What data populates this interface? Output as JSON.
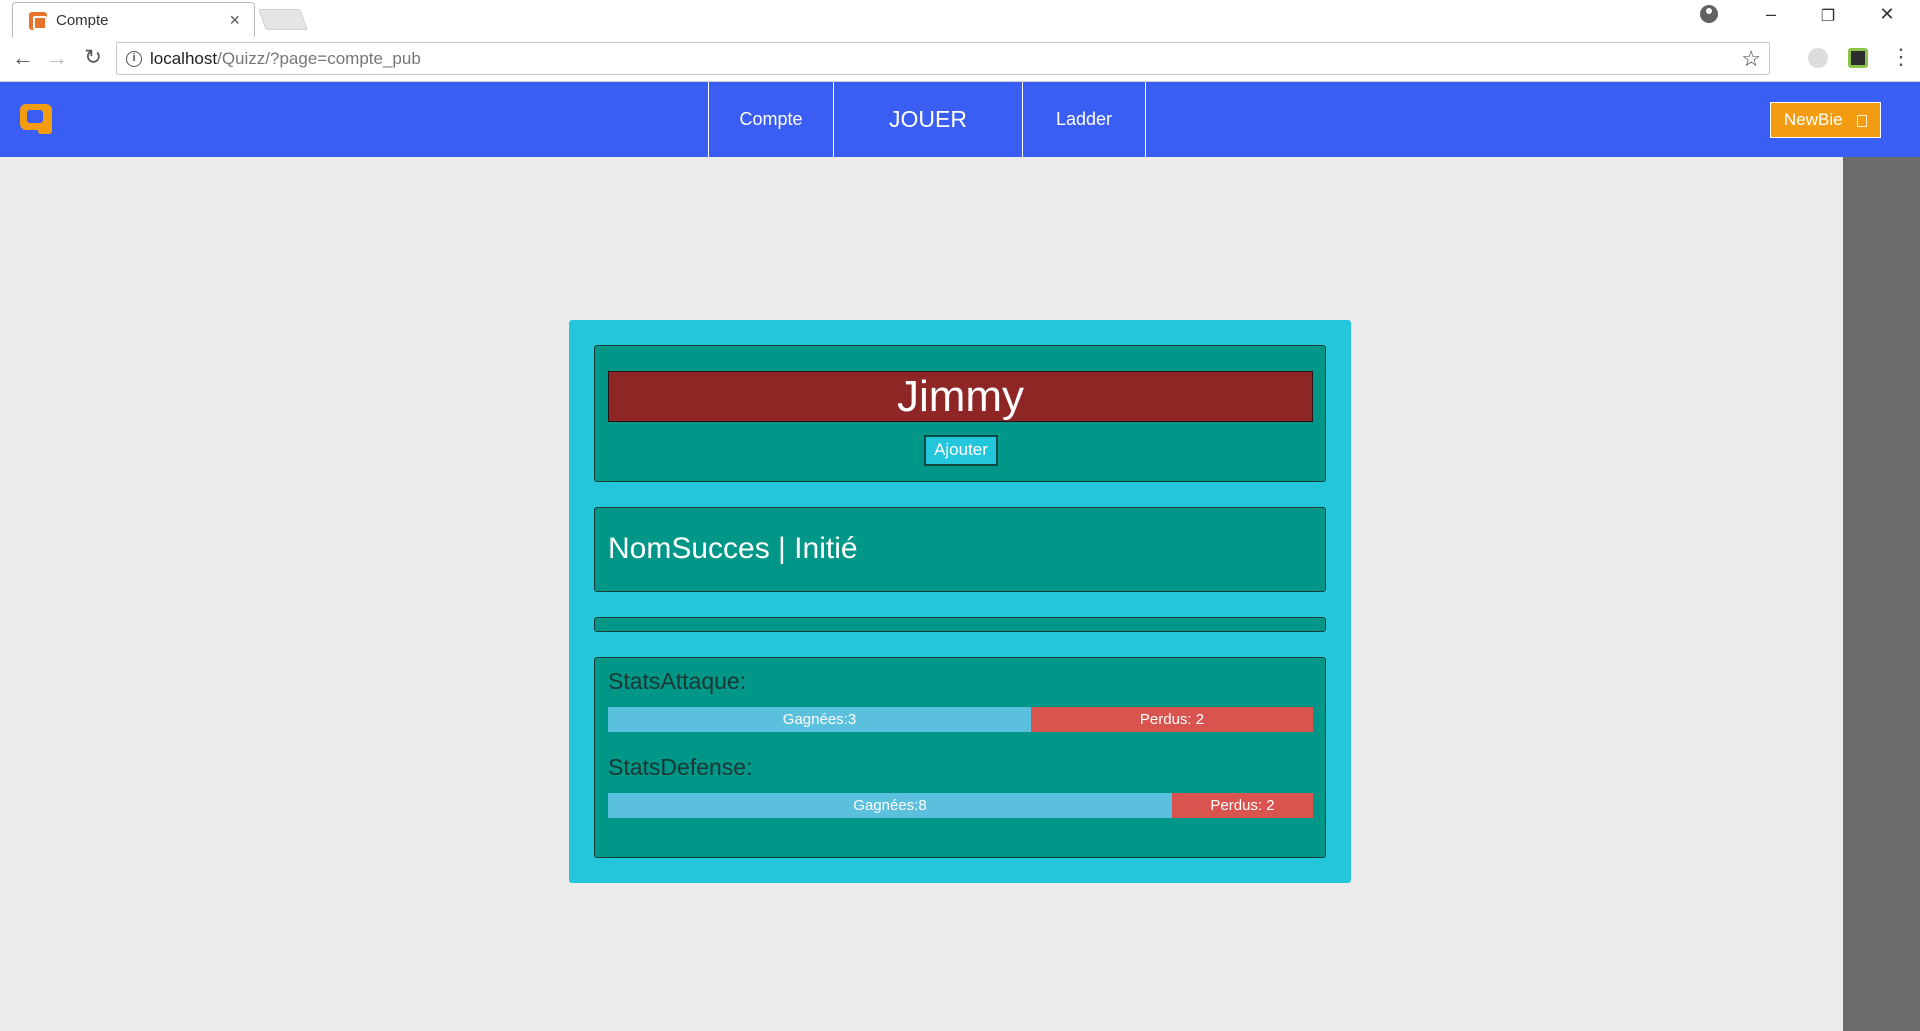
{
  "browser": {
    "tab_title": "Compte",
    "url_host": "localhost",
    "url_path": "/Quizz/?page=compte_pub"
  },
  "nav": {
    "links": [
      {
        "label": "Compte"
      },
      {
        "label": "JOUER"
      },
      {
        "label": "Ladder"
      }
    ],
    "user_badge": "NewBie"
  },
  "profile": {
    "name": "Jimmy",
    "add_button": "Ajouter",
    "success": "NomSucces | Initié"
  },
  "stats": {
    "attack": {
      "label": "StatsAttaque:",
      "won_label": "Gagnées:3",
      "lost_label": "Perdus: 2",
      "won_fraction": 0.6
    },
    "defense": {
      "label": "StatsDefense:",
      "won_label": "Gagnées:8",
      "lost_label": "Perdus: 2",
      "won_fraction": 0.8
    }
  },
  "colors": {
    "navbar": "#3a5ef3",
    "card": "#24c6dc",
    "panel": "#009688",
    "name_bar": "#8f2626",
    "won": "#5bc0de",
    "lost": "#d9534f",
    "badge": "#f39c12"
  }
}
